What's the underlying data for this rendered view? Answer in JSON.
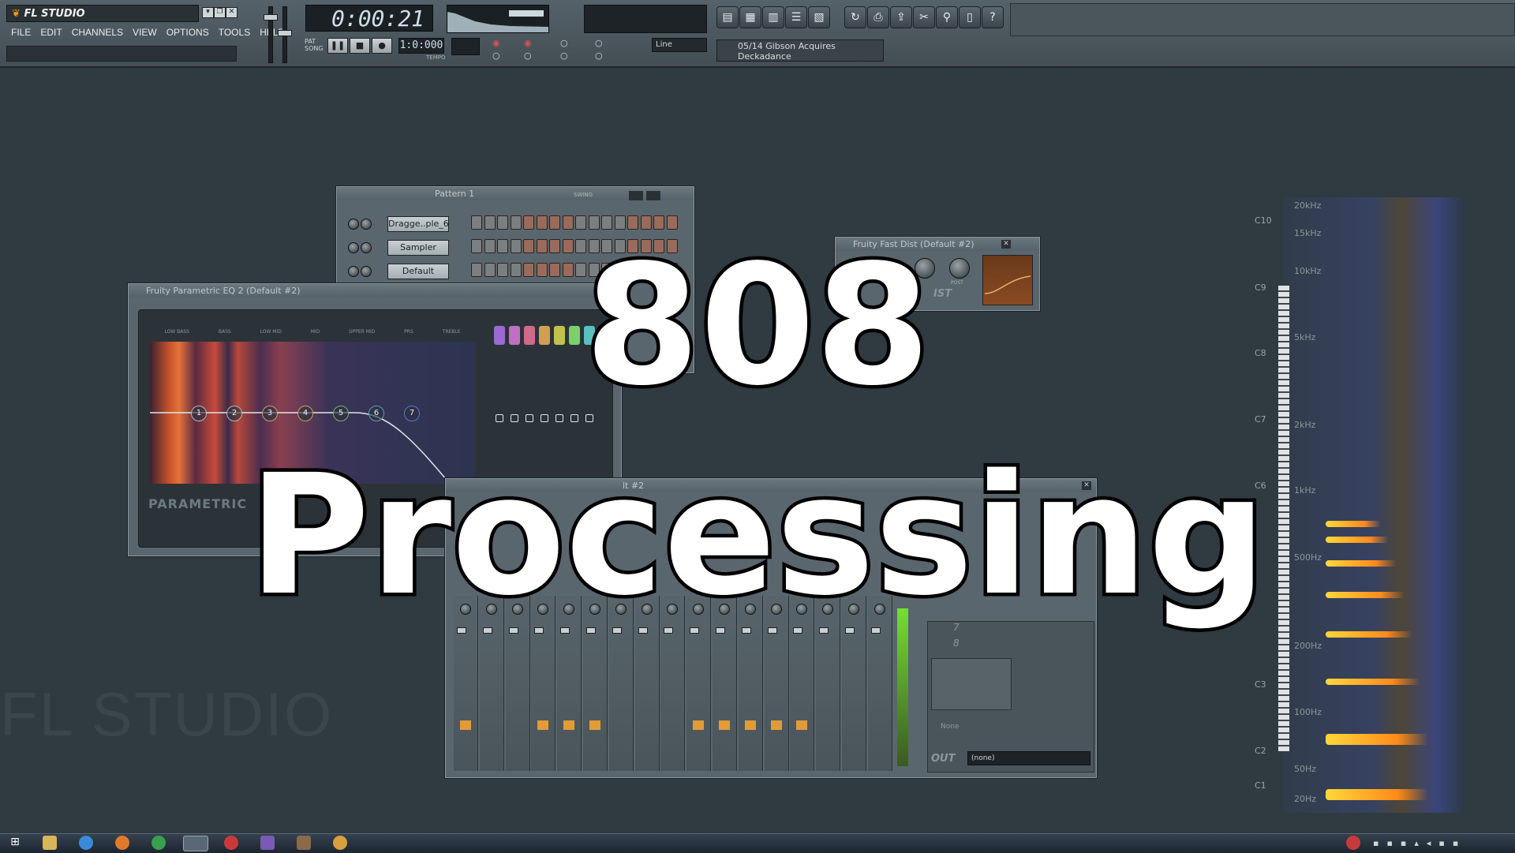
{
  "app": {
    "logo": "FL STUDIO",
    "menu": [
      "FILE",
      "EDIT",
      "CHANNELS",
      "VIEW",
      "OPTIONS",
      "TOOLS",
      "HELP"
    ],
    "time_display": "0:00:21",
    "bar_beat": "1:0:000",
    "tempo_label": "TEMPO",
    "pat_label": "PAT",
    "song_label": "SONG",
    "snap_value": "Line",
    "hint_line1": "05/14  Gibson Acquires",
    "hint_line2": "Deckadance"
  },
  "step_sequencer": {
    "title": "Pattern 1",
    "swing_label": "SWING",
    "channels": [
      "Dragge..ple_6",
      "Sampler",
      "Default"
    ]
  },
  "eq_window": {
    "title": "Fruity Parametric EQ 2 (Default #2)",
    "band_labels": [
      "LOW BASS",
      "BASS",
      "LOW MID",
      "MID",
      "UPPER MID",
      "PRS",
      "TREBLE"
    ],
    "brand": "PARAMETRIC",
    "nodes": [
      "1",
      "2",
      "3",
      "4",
      "5",
      "6",
      "7"
    ]
  },
  "dist_window": {
    "title": "Fruity Fast Dist (Default #2)",
    "post_label": "POST",
    "brand": "IST"
  },
  "mixer_window": {
    "title": "lt #2",
    "out_label": "OUT",
    "out_value": "(none)",
    "slot_none": "None",
    "slots": [
      "7",
      "8"
    ]
  },
  "spectrum": {
    "freq_labels": [
      "20kHz",
      "15kHz",
      "10kHz",
      "5kHz",
      "2kHz",
      "1kHz",
      "500Hz",
      "200Hz",
      "100Hz",
      "50Hz",
      "20Hz"
    ],
    "note_labels": [
      "C10",
      "C9",
      "C8",
      "C7",
      "C6",
      "C3",
      "C2",
      "C1"
    ]
  },
  "watermark": "FL STUDIO",
  "overlay": {
    "line1": "808",
    "line2": "Processing"
  },
  "colors": {
    "background": "#2f3a41",
    "accent_orange": "#e39b38",
    "title_fill": "#ffffff"
  }
}
